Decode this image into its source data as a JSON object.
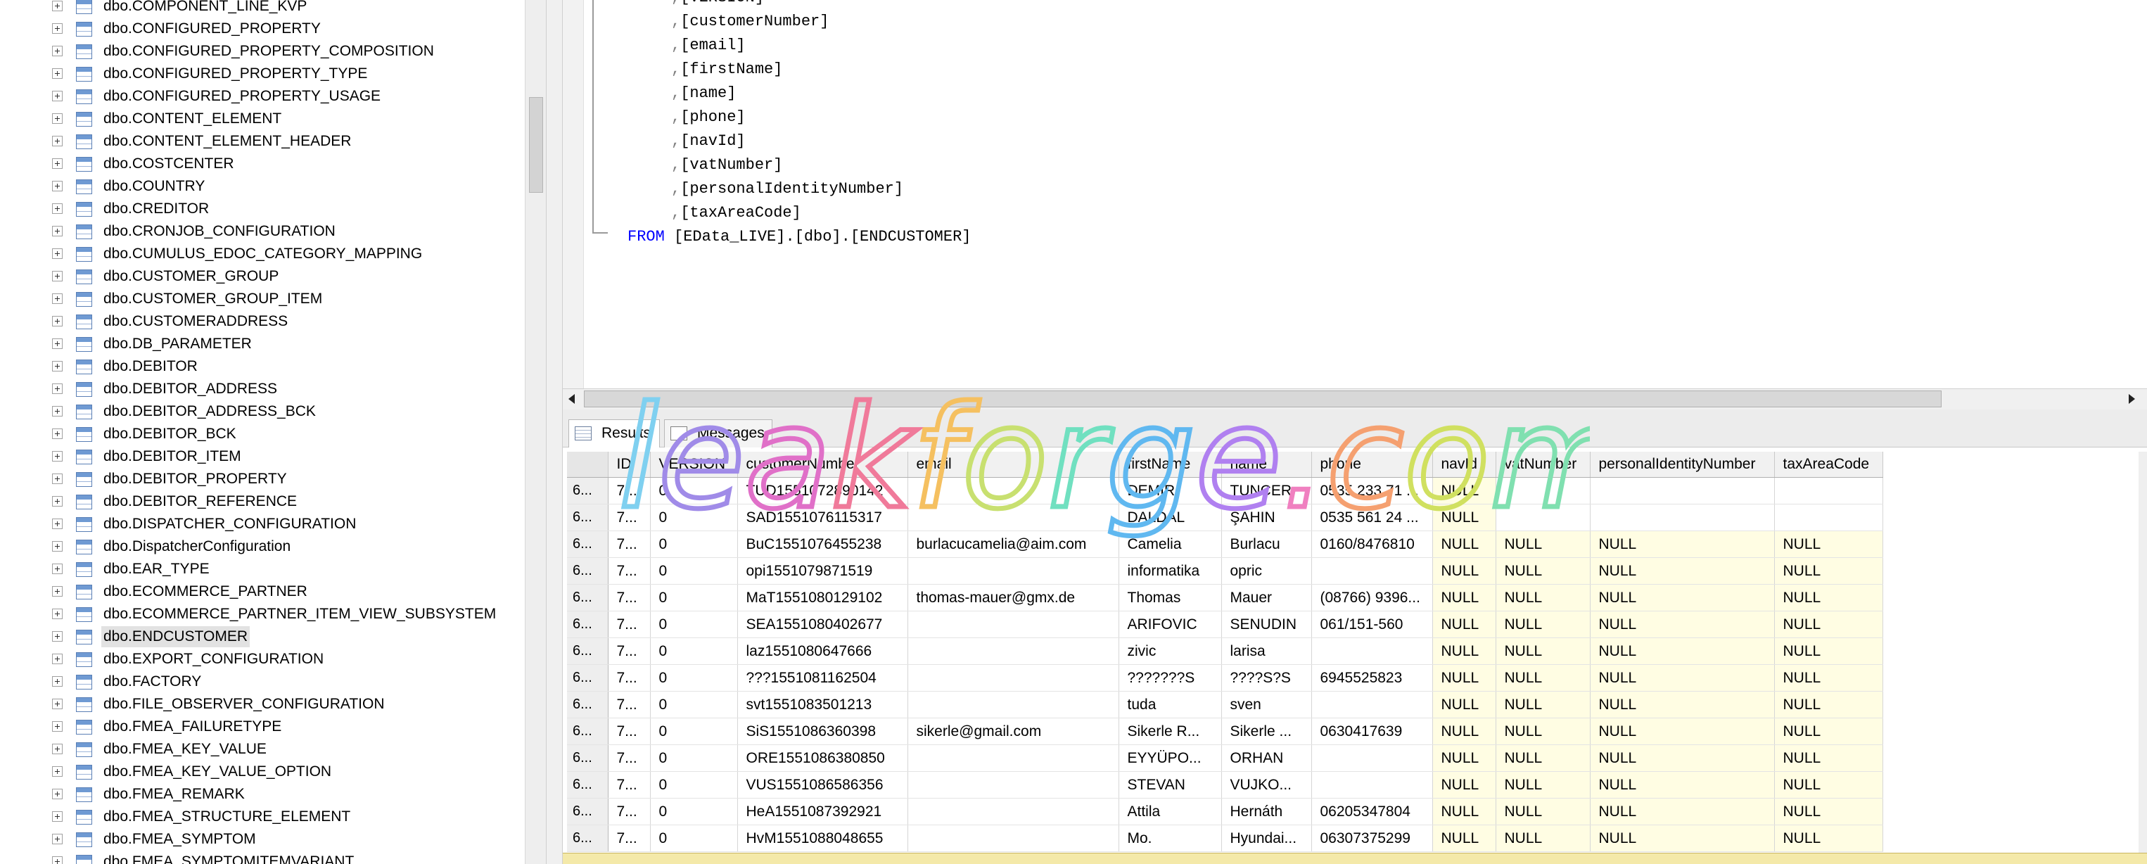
{
  "tree": {
    "items": [
      "dbo.COMPONENT_LINE_KVP",
      "dbo.CONFIGURED_PROPERTY",
      "dbo.CONFIGURED_PROPERTY_COMPOSITION",
      "dbo.CONFIGURED_PROPERTY_TYPE",
      "dbo.CONFIGURED_PROPERTY_USAGE",
      "dbo.CONTENT_ELEMENT",
      "dbo.CONTENT_ELEMENT_HEADER",
      "dbo.COSTCENTER",
      "dbo.COUNTRY",
      "dbo.CREDITOR",
      "dbo.CRONJOB_CONFIGURATION",
      "dbo.CUMULUS_EDOC_CATEGORY_MAPPING",
      "dbo.CUSTOMER_GROUP",
      "dbo.CUSTOMER_GROUP_ITEM",
      "dbo.CUSTOMERADDRESS",
      "dbo.DB_PARAMETER",
      "dbo.DEBITOR",
      "dbo.DEBITOR_ADDRESS",
      "dbo.DEBITOR_ADDRESS_BCK",
      "dbo.DEBITOR_BCK",
      "dbo.DEBITOR_ITEM",
      "dbo.DEBITOR_PROPERTY",
      "dbo.DEBITOR_REFERENCE",
      "dbo.DISPATCHER_CONFIGURATION",
      "dbo.DispatcherConfiguration",
      "dbo.EAR_TYPE",
      "dbo.ECOMMERCE_PARTNER",
      "dbo.ECOMMERCE_PARTNER_ITEM_VIEW_SUBSYSTEM",
      "dbo.ENDCUSTOMER",
      "dbo.EXPORT_CONFIGURATION",
      "dbo.FACTORY",
      "dbo.FILE_OBSERVER_CONFIGURATION",
      "dbo.FMEA_FAILURETYPE",
      "dbo.FMEA_KEY_VALUE",
      "dbo.FMEA_KEY_VALUE_OPTION",
      "dbo.FMEA_REMARK",
      "dbo.FMEA_STRUCTURE_ELEMENT",
      "dbo.FMEA_SYMPTOM",
      "dbo.FMEA_SYMPTOMITEMVARIANT"
    ],
    "selected_index": 28
  },
  "editor": {
    "lines": [
      ",[VERSION]",
      ",[customerNumber]",
      ",[email]",
      ",[firstName]",
      ",[name]",
      ",[phone]",
      ",[navId]",
      ",[vatNumber]",
      ",[personalIdentityNumber]",
      ",[taxAreaCode]"
    ],
    "from_keyword": "FROM",
    "from_target": "[EData_LIVE].[dbo].[ENDCUSTOMER]"
  },
  "tabs": {
    "results": "Results",
    "messages": "Messages"
  },
  "grid": {
    "columns": [
      "ID",
      "VERSION",
      "customerNumber",
      "email",
      "firstName",
      "name",
      "phone",
      "navId",
      "vatNumber",
      "personalIdentityNumber",
      "taxAreaCode"
    ],
    "rows": [
      [
        "6...",
        "7...",
        "0",
        "TUD1551072890142",
        "",
        "DEMIR",
        "TUNCER",
        "0535 233 71 ...",
        "NULL",
        "",
        "",
        ""
      ],
      [
        "6...",
        "7...",
        "0",
        "SAD1551076115317",
        "",
        "DALDAL",
        "ŞAHIN",
        "0535 561 24 ...",
        "NULL",
        "",
        "",
        ""
      ],
      [
        "6...",
        "7...",
        "0",
        "BuC1551076455238",
        "burlacucamelia@aim.com",
        "Camelia",
        "Burlacu",
        "0160/8476810",
        "NULL",
        "NULL",
        "NULL",
        "NULL"
      ],
      [
        "6...",
        "7...",
        "0",
        "opi1551079871519",
        "",
        "informatika",
        "opric",
        "",
        "NULL",
        "NULL",
        "NULL",
        "NULL"
      ],
      [
        "6...",
        "7...",
        "0",
        "MaT1551080129102",
        "thomas-mauer@gmx.de",
        "Thomas",
        "Mauer",
        "(08766) 9396...",
        "NULL",
        "NULL",
        "NULL",
        "NULL"
      ],
      [
        "6...",
        "7...",
        "0",
        "SEA1551080402677",
        "",
        "ARIFOVIC",
        "SENUDIN",
        "061/151-560",
        "NULL",
        "NULL",
        "NULL",
        "NULL"
      ],
      [
        "6...",
        "7...",
        "0",
        "laz1551080647666",
        "",
        "zivic",
        "larisa",
        "",
        "NULL",
        "NULL",
        "NULL",
        "NULL"
      ],
      [
        "6...",
        "7...",
        "0",
        "???1551081162504",
        "",
        "???????S",
        "????S?S",
        "6945525823",
        "NULL",
        "NULL",
        "NULL",
        "NULL"
      ],
      [
        "6...",
        "7...",
        "0",
        "svt1551083501213",
        "",
        "tuda",
        "sven",
        "",
        "NULL",
        "NULL",
        "NULL",
        "NULL"
      ],
      [
        "6...",
        "7...",
        "0",
        "SiS1551086360398",
        "sikerle@gmail.com",
        "Sikerle R...",
        "Sikerle ...",
        "0630417639",
        "NULL",
        "NULL",
        "NULL",
        "NULL"
      ],
      [
        "6...",
        "7...",
        "0",
        "ORE1551086380850",
        "",
        "EYYÜPO...",
        "ORHAN",
        "",
        "NULL",
        "NULL",
        "NULL",
        "NULL"
      ],
      [
        "6...",
        "7...",
        "0",
        "VUS1551086586356",
        "",
        "STEVAN",
        "VUJKO...",
        "",
        "NULL",
        "NULL",
        "NULL",
        "NULL"
      ],
      [
        "6...",
        "7...",
        "0",
        "HeA1551087392921",
        "",
        "Attila",
        "Hernáth",
        "06205347804",
        "NULL",
        "NULL",
        "NULL",
        "NULL"
      ],
      [
        "6...",
        "7...",
        "0",
        "HvM1551088048655",
        "",
        "Mo.",
        "Hyundai...",
        "06307375299",
        "NULL",
        "NULL",
        "NULL",
        "NULL"
      ]
    ]
  },
  "watermark": "leakforge.com",
  "colors": {
    "keyword": "#0000ff",
    "null_cell": "#fffde3",
    "status_bar": "#f4e9a9"
  }
}
